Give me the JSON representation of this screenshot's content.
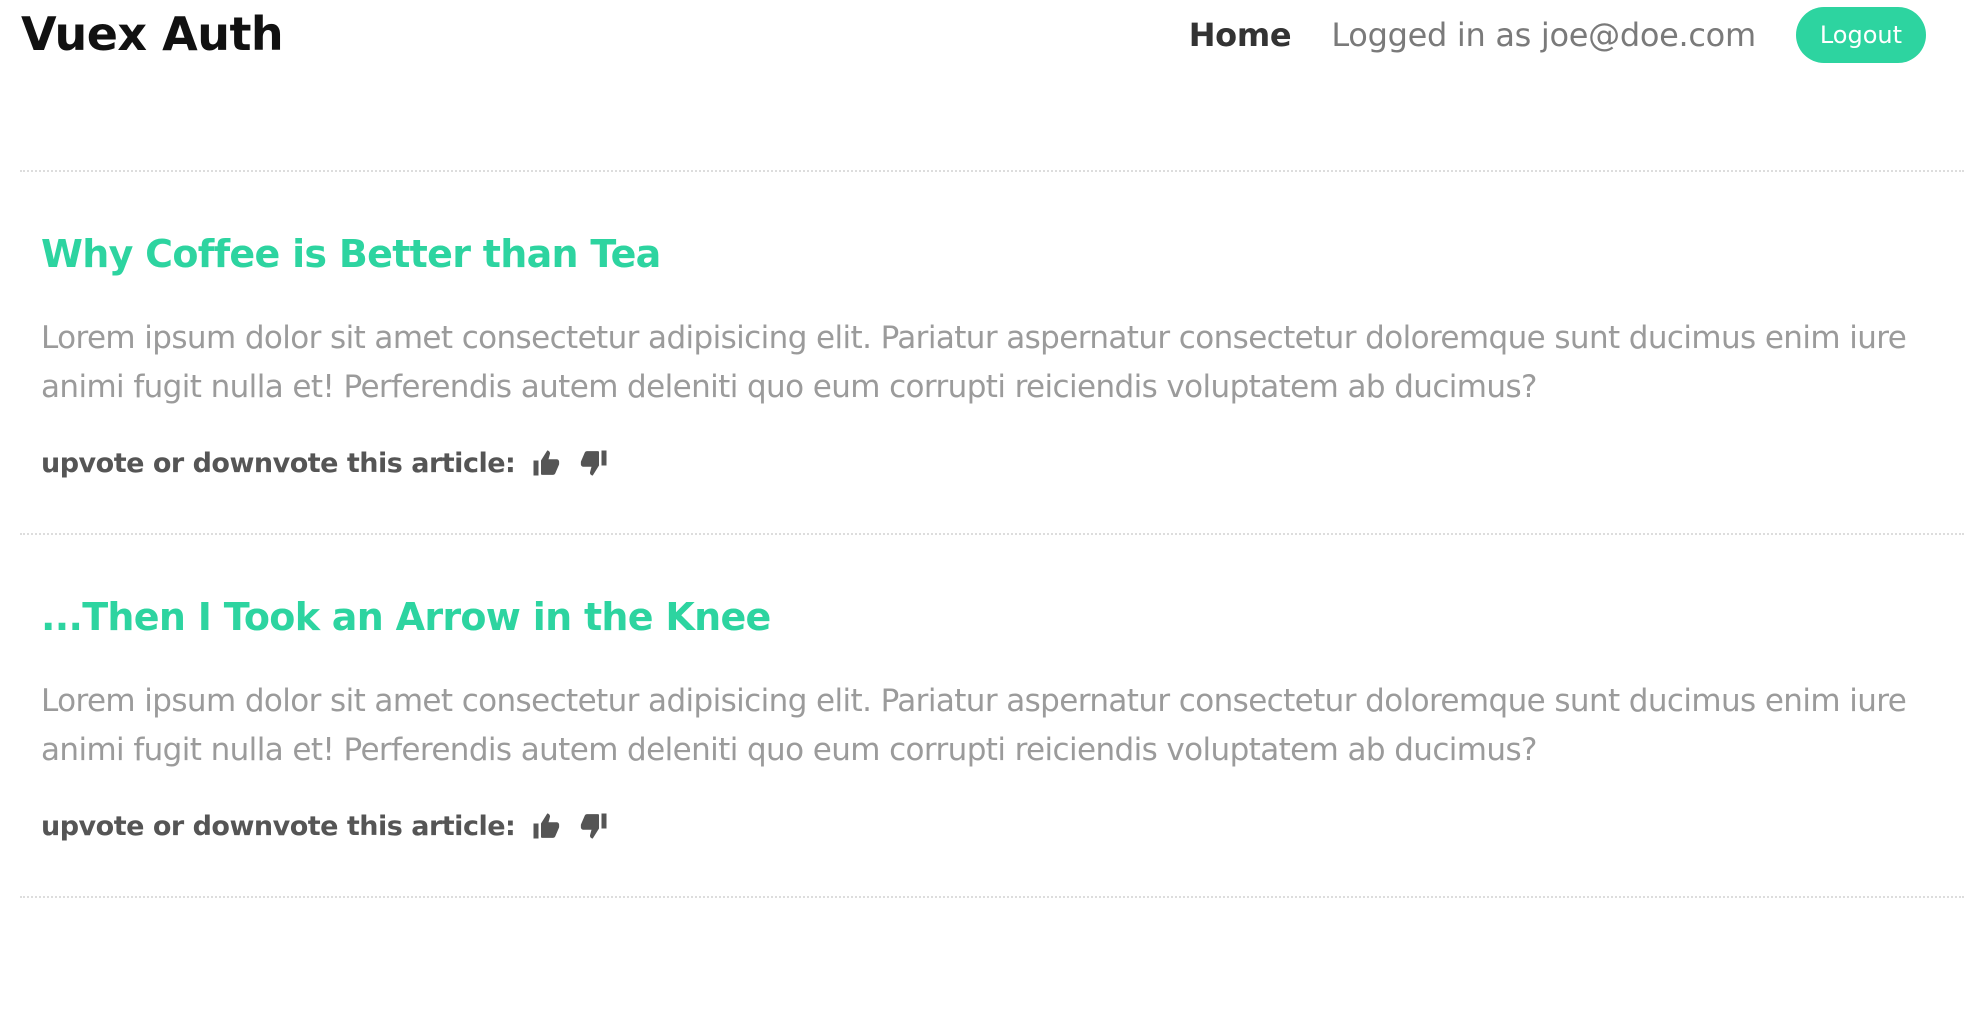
{
  "header": {
    "brand": "Vuex Auth",
    "nav_home": "Home",
    "logged_in_text": "Logged in as joe@doe.com",
    "logout_label": "Logout"
  },
  "articles": [
    {
      "title": "Why Coffee is Better than Tea",
      "body": "Lorem ipsum dolor sit amet consectetur adipisicing elit. Pariatur aspernatur consectetur doloremque sunt ducimus enim iure animi fugit nulla et! Perferendis autem deleniti quo eum corrupti reiciendis voluptatem ab ducimus?",
      "vote_label": "upvote or downvote this article:"
    },
    {
      "title": "...Then I Took an Arrow in the Knee",
      "body": "Lorem ipsum dolor sit amet consectetur adipisicing elit. Pariatur aspernatur consectetur doloremque sunt ducimus enim iure animi fugit nulla et! Perferendis autem deleniti quo eum corrupti reiciendis voluptatem ab ducimus?",
      "vote_label": "upvote or downvote this article:"
    }
  ],
  "icons": {
    "upvote": "thumbs-up-icon",
    "downvote": "thumbs-down-icon"
  },
  "colors": {
    "accent": "#2dd4a0",
    "body_text": "#9b9b9b",
    "vote_text": "#555555"
  }
}
